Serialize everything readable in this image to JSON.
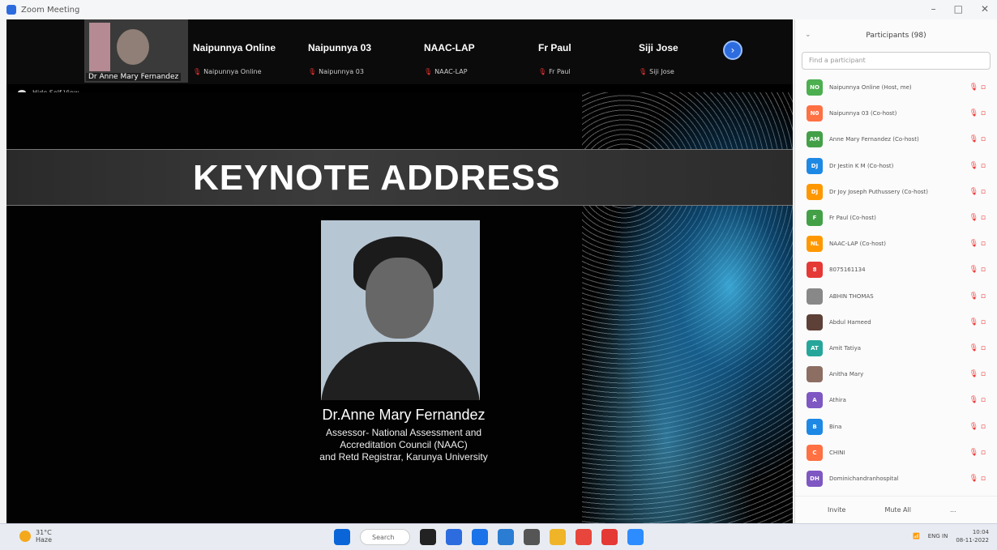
{
  "window": {
    "title": "Zoom Meeting",
    "controls": [
      "–",
      "□",
      "✕"
    ]
  },
  "self_view": {
    "name": "Dr Anne Mary Fernandez"
  },
  "participants_strip": [
    {
      "display": "Naipunnya Online",
      "label": "Naipunnya Online"
    },
    {
      "display": "Naipunnya 03",
      "label": "Naipunnya 03"
    },
    {
      "display": "NAAC-LAP",
      "label": "NAAC-LAP"
    },
    {
      "display": "Fr Paul",
      "label": "Fr Paul"
    },
    {
      "display": "Siji Jose",
      "label": "Siji Jose"
    }
  ],
  "hide_self": "Hide Self View",
  "slide": {
    "title": "KEYNOTE ADDRESS",
    "speaker_name": "Dr.Anne Mary Fernandez",
    "speaker_lines": [
      "Assessor- National Assessment and",
      "Accreditation Council (NAAC)",
      "and Retd Registrar, Karunya University"
    ]
  },
  "panel": {
    "title": "Participants (98)",
    "search_placeholder": "Find a participant",
    "rows": [
      {
        "initials": "NO",
        "color": "#4caf50",
        "name": "Naipunnya Online (Host, me)"
      },
      {
        "initials": "N0",
        "color": "#ff7043",
        "name": "Naipunnya 03 (Co-host)"
      },
      {
        "initials": "AM",
        "color": "#43a047",
        "name": "Anne Mary Fernandez (Co-host)"
      },
      {
        "initials": "DJ",
        "color": "#1e88e5",
        "name": "Dr Jestin K M (Co-host)"
      },
      {
        "initials": "DJ",
        "color": "#ff9800",
        "name": "Dr Joy Joseph Puthussery (Co-host)"
      },
      {
        "initials": "F",
        "color": "#43a047",
        "name": "Fr Paul (Co-host)"
      },
      {
        "initials": "NL",
        "color": "#ff9800",
        "name": "NAAC-LAP (Co-host)"
      },
      {
        "initials": "8",
        "color": "#e53935",
        "name": "8075161134"
      },
      {
        "initials": "",
        "color": "#888888",
        "name": "ABHIN THOMAS"
      },
      {
        "initials": "",
        "color": "#5d4037",
        "name": "Abdul Hameed"
      },
      {
        "initials": "AT",
        "color": "#26a69a",
        "name": "Amit Tatiya"
      },
      {
        "initials": "",
        "color": "#8d6e63",
        "name": "Anitha Mary"
      },
      {
        "initials": "A",
        "color": "#7e57c2",
        "name": "Athira"
      },
      {
        "initials": "B",
        "color": "#1e88e5",
        "name": "Bina"
      },
      {
        "initials": "C",
        "color": "#ff7043",
        "name": "CHINI"
      },
      {
        "initials": "DH",
        "color": "#7e57c2",
        "name": "Dominichandranhospital"
      }
    ],
    "footer": {
      "invite": "Invite",
      "mute_all": "Mute All",
      "more": "..."
    }
  },
  "taskbar": {
    "weather": {
      "temp": "31°C",
      "cond": "Haze"
    },
    "search": "Search",
    "tray": {
      "lang": "ENG IN",
      "time": "10:04",
      "date": "08-11-2022"
    },
    "icon_colors": [
      "#0a66d8",
      "#222222",
      "#2d6cdf",
      "#1a73e8",
      "#2b7cd3",
      "#555555",
      "#f0b429",
      "#e8453c",
      "#e53935",
      "#2d8cff"
    ]
  }
}
